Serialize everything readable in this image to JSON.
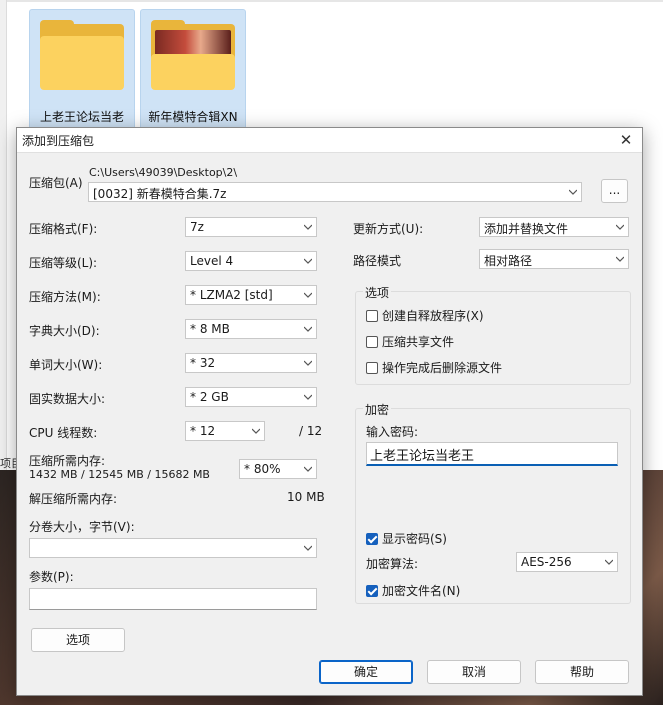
{
  "explorer": {
    "files": [
      {
        "name": "上老王论坛当老"
      },
      {
        "name": "新年模特合辑XN"
      }
    ],
    "side_label": "项目"
  },
  "dialog": {
    "title": "添加到压缩包",
    "archive": {
      "label": "压缩包(A)",
      "path": "C:\\Users\\49039\\Desktop\\2\\",
      "name": "[0032] 新春模特合集.7z",
      "browse_label": "..."
    },
    "left": {
      "format": {
        "label": "压缩格式(F):",
        "value": "7z"
      },
      "level": {
        "label": "压缩等级(L):",
        "value": "Level 4"
      },
      "method": {
        "label": "压缩方法(M):",
        "value": "* LZMA2 [std]"
      },
      "dict": {
        "label": "字典大小(D):",
        "value": "* 8 MB"
      },
      "word": {
        "label": "单词大小(W):",
        "value": "* 32"
      },
      "solid": {
        "label": "固实数据大小:",
        "value": "* 2 GB"
      },
      "threads": {
        "label": "CPU 线程数:",
        "value": "* 12",
        "total": "/ 12"
      },
      "mem": {
        "label": "压缩所需内存:",
        "detail": "1432 MB / 12545 MB / 15682 MB",
        "value": "* 80%"
      },
      "decomp": {
        "label": "解压缩所需内存:",
        "value": "10 MB"
      },
      "split": {
        "label": "分卷大小，字节(V):",
        "value": ""
      },
      "params": {
        "label": "参数(P):",
        "value": ""
      },
      "options_button": "选项"
    },
    "right": {
      "update": {
        "label": "更新方式(U):",
        "value": "添加并替换文件"
      },
      "pathmode": {
        "label": "路径模式",
        "value": "相对路径"
      },
      "options": {
        "title": "选项",
        "sfx": {
          "label": "创建自释放程序(X)",
          "checked": false
        },
        "shared": {
          "label": "压缩共享文件",
          "checked": false
        },
        "delete": {
          "label": "操作完成后删除源文件",
          "checked": false
        }
      },
      "encryption": {
        "title": "加密",
        "pwd_label": "输入密码:",
        "password": "上老王论坛当老王",
        "show": {
          "label": "显示密码(S)",
          "checked": true
        },
        "method_label": "加密算法:",
        "method": "AES-256",
        "encrypt_names": {
          "label": "加密文件名(N)",
          "checked": true
        }
      }
    },
    "buttons": {
      "ok": "确定",
      "cancel": "取消",
      "help": "帮助"
    }
  }
}
